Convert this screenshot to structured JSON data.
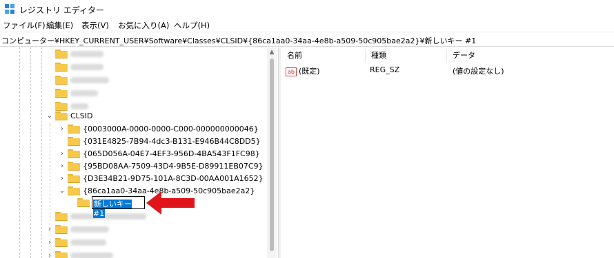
{
  "window": {
    "title": "レジストリ エディター"
  },
  "menu": [
    "ファイル(F)",
    "編集(E)",
    "表示(V)",
    "お気に入り(A)",
    "ヘルプ(H)"
  ],
  "address": "コンピューター¥HKEY_CURRENT_USER¥Software¥Classes¥CLSID¥{86ca1aa0-34aa-4e8b-a509-50c905bae2a2}¥新しいキー #1",
  "tree": {
    "clsid_label": "CLSID",
    "children": [
      "{0003000A-0000-0000-C000-000000000046}",
      "{031E4825-7B94-4dc3-B131-E946B44C8DD5}",
      "{065D056A-04E7-4EF3-956D-4BA543F1FC98}",
      "{95BD08AA-7509-43D4-9B5E-D89911EB07C9}",
      "{D3E34B21-9D75-101A-8C3D-00AA001A1652}",
      "{86ca1aa0-34aa-4e8b-a509-50c905bae2a2}"
    ],
    "new_key_edit": "新しいキー #1"
  },
  "list": {
    "columns": [
      "名前",
      "種類",
      "データ"
    ],
    "rows": [
      {
        "icon": "ab",
        "name": "(既定)",
        "type": "REG_SZ",
        "data": "(値の設定なし)"
      }
    ]
  },
  "colors": {
    "arrow": "#e0151b",
    "folder": "#f6c94a",
    "selection": "#0078d7"
  }
}
